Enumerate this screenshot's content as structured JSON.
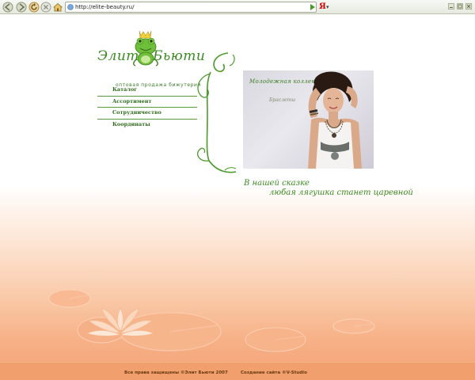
{
  "browser": {
    "url": "http://elite-beauty.ru/",
    "search_engine_label": "Я",
    "toolbar_icons": [
      "back-icon",
      "forward-icon",
      "reload-icon",
      "stop-icon",
      "home-icon"
    ],
    "window_icons": [
      "minimize-icon",
      "maximize-icon",
      "close-icon"
    ]
  },
  "logo": {
    "word1": "Элит",
    "word2": "Бьюти",
    "tagline": "оптовая продажа бижутерии"
  },
  "menu": {
    "items": [
      {
        "label": "Каталог"
      },
      {
        "label": "Ассортимент"
      },
      {
        "label": "Сотрудничество"
      },
      {
        "label": "Координаты"
      }
    ]
  },
  "promo": {
    "title": "Молодежная коллекция",
    "subtitle": "Браслеты"
  },
  "slogan": {
    "line1": "В нашей сказке",
    "line2": "любая лягушка станет царевной"
  },
  "footer": {
    "copyright": "Все права защищены ©Элит Бьюти 2007",
    "studio": "Создание сайта ©V-Studio"
  },
  "colors": {
    "brand_green": "#3a8a20",
    "footer_orange": "#f19f6c",
    "lily_color": "#f6b48c"
  }
}
